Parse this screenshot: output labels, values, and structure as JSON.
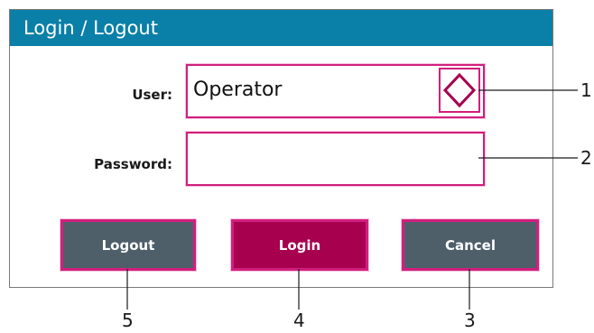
{
  "dialog": {
    "title": "Login / Logout",
    "user_label": "User:",
    "user_value": "Operator",
    "password_label": "Password:",
    "password_value": "",
    "buttons": {
      "logout": "Logout",
      "login": "Login",
      "cancel": "Cancel"
    }
  },
  "callouts": [
    "1",
    "2",
    "3",
    "4",
    "5"
  ],
  "colors": {
    "titlebar": "#0a7fa8",
    "highlight": "#d11f7e",
    "button_gray": "#4e5f6a",
    "button_primary": "#a6004f"
  },
  "icons": {
    "user_dropdown": "up-down-chevron-icon"
  }
}
